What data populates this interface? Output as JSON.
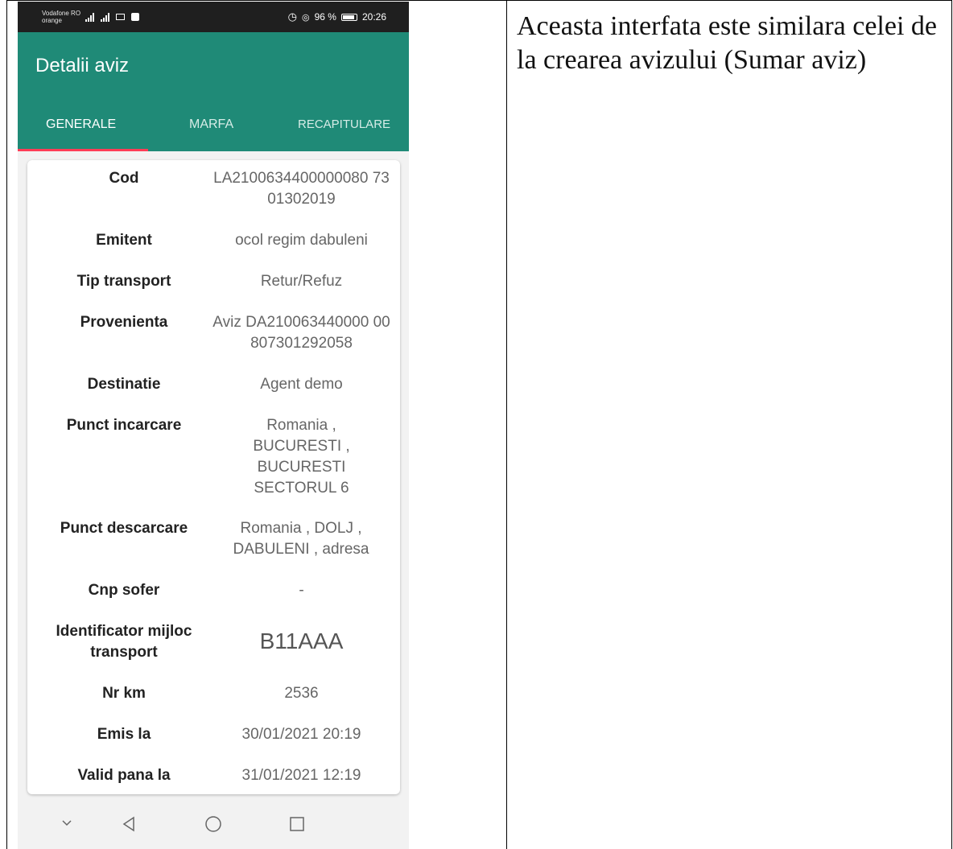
{
  "status_bar": {
    "carrier_line1": "Vodafone RO",
    "carrier_line2": "orange",
    "battery_percent": "96 %",
    "time": "20:26"
  },
  "app_bar": {
    "title": "Detalii aviz",
    "tabs": [
      {
        "label": "GENERALE",
        "active": true
      },
      {
        "label": "MARFA",
        "active": false
      },
      {
        "label": "RECAPITULARE",
        "active": false
      }
    ]
  },
  "details": [
    {
      "label": "Cod",
      "value": "LA2100634400000080 7301302019"
    },
    {
      "label": "Emitent",
      "value": "ocol regim dabuleni"
    },
    {
      "label": "Tip transport",
      "value": "Retur/Refuz"
    },
    {
      "label": "Provenienta",
      "value": "Aviz DA210063440000 00807301292058"
    },
    {
      "label": "Destinatie",
      "value": "Agent demo"
    },
    {
      "label": "Punct incarcare",
      "value": "Romania , BUCURESTI , BUCURESTI SECTORUL 6"
    },
    {
      "label": "Punct descarcare",
      "value": "Romania , DOLJ , DABULENI , adresa"
    },
    {
      "label": "Cnp sofer",
      "value": "-"
    },
    {
      "label": "Identificator mijloc transport",
      "value": "B11AAA"
    },
    {
      "label": "Nr km",
      "value": "2536"
    },
    {
      "label": "Emis la",
      "value": "30/01/2021 20:19"
    },
    {
      "label": "Valid pana la",
      "value": "31/01/2021 12:19"
    }
  ],
  "description": "Aceasta interfata este similara celei de la crearea avizului (Sumar aviz)",
  "colors": {
    "app_bar": "#1f8a77",
    "tab_indicator": "#ff3d57",
    "status_bar": "#1f1f1f"
  }
}
